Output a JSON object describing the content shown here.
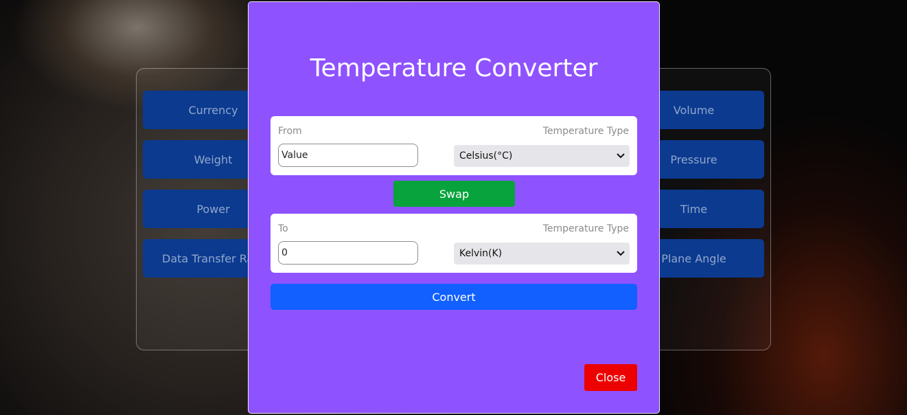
{
  "background": {
    "categories_left": [
      "Currency",
      "Weight",
      "Power",
      "Data Transfer Rate"
    ],
    "categories_right": [
      "Volume",
      "Pressure",
      "Time",
      "Plane Angle"
    ]
  },
  "modal": {
    "title": "Temperature Converter",
    "from_card": {
      "label": "From",
      "type_label": "Temperature Type",
      "input_value": "Value",
      "selected_unit": "Celsius(°C)"
    },
    "swap_label": "Swap",
    "to_card": {
      "label": "To",
      "type_label": "Temperature Type",
      "input_value": "0",
      "selected_unit": "Kelvin(K)"
    },
    "convert_label": "Convert",
    "close_label": "Close"
  },
  "colors": {
    "modal_bg": "#8f52ff",
    "swap": "#08a33c",
    "convert": "#1160ff",
    "close": "#ec0000",
    "category_button": "#0b3a8f"
  }
}
